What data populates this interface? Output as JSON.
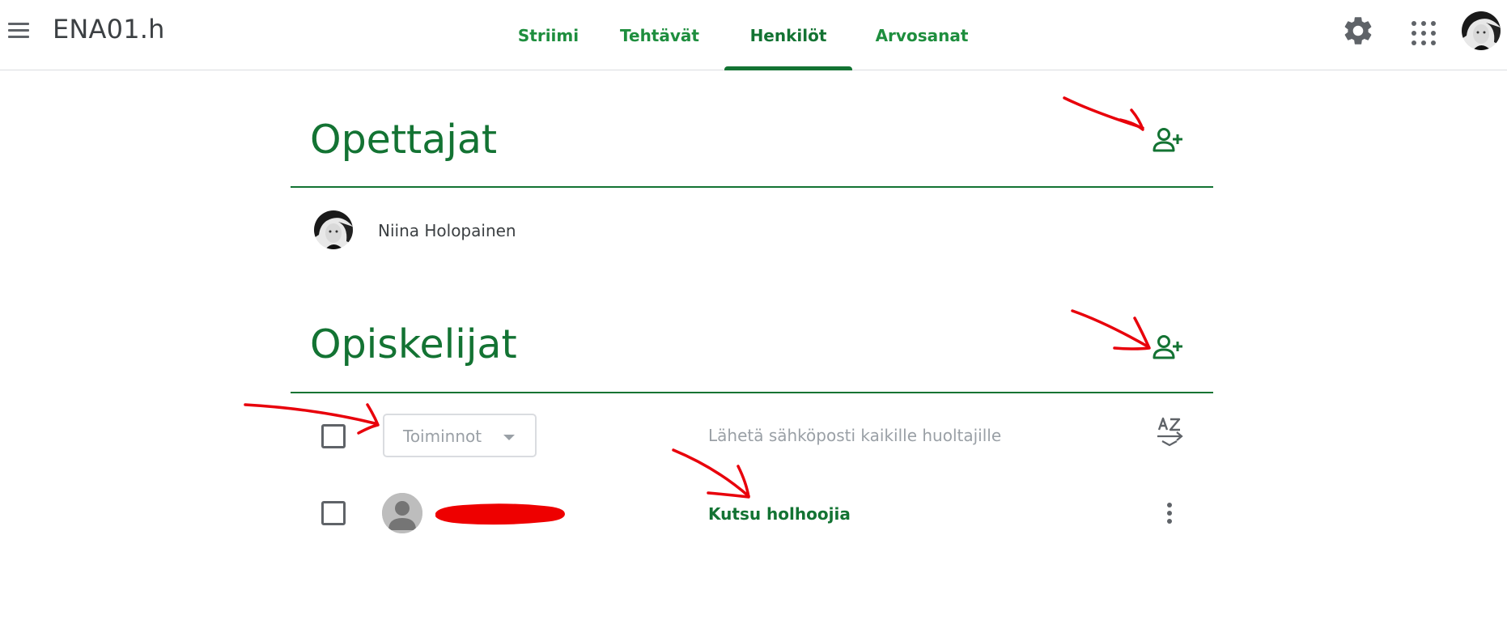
{
  "header": {
    "class_title": "ENA01.h",
    "tabs": [
      {
        "label": "Striimi"
      },
      {
        "label": "Tehtävät"
      },
      {
        "label": "Henkilöt",
        "active": true
      },
      {
        "label": "Arvosanat"
      }
    ],
    "icons": [
      "menu-icon",
      "gear-icon",
      "apps-grid-icon",
      "account-avatar"
    ]
  },
  "teachers": {
    "title": "Opettajat",
    "list": [
      {
        "name": "Niina Holopainen"
      }
    ]
  },
  "students": {
    "title": "Opiskelijat",
    "actions_label": "Toiminnot",
    "email_all_guardians": "Lähetä sähköposti kaikille huoltajille",
    "rows": [
      {
        "name_redacted": true,
        "invite_label": "Kutsu holhoojia"
      }
    ]
  },
  "colors": {
    "brand_green": "#137333",
    "tab_green": "#1e8e3e",
    "annotation_red": "#e8000b"
  }
}
